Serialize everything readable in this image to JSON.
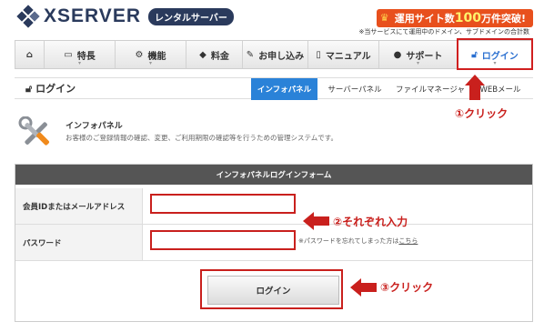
{
  "header": {
    "logo_text": "XSERVER",
    "logo_badge": "レンタルサーバー",
    "promo_prefix": "運用サイト数",
    "promo_number": "100",
    "promo_suffix": "万件突破!",
    "promo_note": "※当サービスにて運用中のドメイン、サブドメインの合計数"
  },
  "nav": {
    "items": [
      {
        "icon": "home-icon",
        "glyph": "⌂",
        "label": ""
      },
      {
        "icon": "monitor-icon",
        "glyph": "▭",
        "label": "特長"
      },
      {
        "icon": "gears-icon",
        "glyph": "⚙",
        "label": "機能"
      },
      {
        "icon": "tag-icon",
        "glyph": "◆",
        "label": "料金"
      },
      {
        "icon": "pencil-icon",
        "glyph": "✎",
        "label": "お申し込み"
      },
      {
        "icon": "book-icon",
        "glyph": "▯",
        "label": "マニュアル"
      },
      {
        "icon": "user-icon",
        "glyph": "●",
        "label": "サポート"
      },
      {
        "icon": "lock-icon",
        "glyph": "🔓",
        "label": "ログイン"
      }
    ]
  },
  "subbar": {
    "title": "ログイン",
    "tabs": [
      "インフォパネル",
      "サーバーパネル",
      "ファイルマネージャ",
      "WEBメール"
    ]
  },
  "callouts": {
    "step1": "①クリック",
    "step2": "②それぞれ入力",
    "step3": "③クリック"
  },
  "intro": {
    "title": "インフォパネル",
    "description": "お客様のご登録情報の確認、変更、ご利用期限の確認等を行うための管理システムです。"
  },
  "form": {
    "heading": "インフォパネルログインフォーム",
    "id_label": "会員IDまたはメールアドレス",
    "id_value": "",
    "password_label": "パスワード",
    "password_value": "",
    "forgot_text": "※パスワードを忘れてしまった方は",
    "forgot_link": "こちら",
    "submit_label": "ログイン"
  },
  "colors": {
    "brand": "#2a3a5c",
    "accent_red": "#c9201d",
    "active_tab": "#2a82d8",
    "promo": "#e8501d"
  }
}
